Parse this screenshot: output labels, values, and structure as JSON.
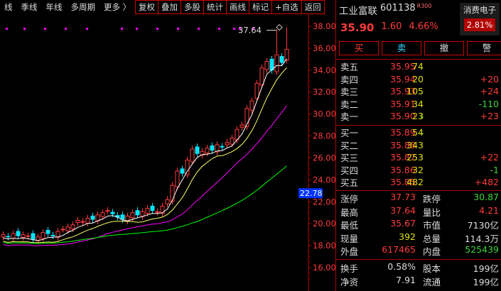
{
  "toolbar": {
    "left_items": [
      "线",
      "季线",
      "年线",
      "多周期",
      "更多 〉"
    ],
    "right_buttons": [
      "复权",
      "叠加",
      "多股",
      "统计",
      "画线",
      "标记",
      "+自选",
      "返回"
    ]
  },
  "stock": {
    "name": "工业富联",
    "code": "601138",
    "badge": "R300",
    "price": "35.90",
    "change": "1.60",
    "change_pct": "4.66%",
    "sector_name": "消费电子",
    "sector_pct": "2.81%"
  },
  "trade_buttons": [
    "买",
    "卖",
    "撤",
    "警"
  ],
  "sell_orders": [
    {
      "label": "卖五",
      "price": "35.95",
      "arrow": "",
      "vol": "74",
      "chg": "",
      "chg_color": "#ff3b3b"
    },
    {
      "label": "卖四",
      "price": "35.94",
      "arrow": "",
      "vol": "20",
      "chg": "+20",
      "chg_color": "#ff3b3b"
    },
    {
      "label": "卖三",
      "price": "35.93",
      "arrow": "",
      "vol": "105",
      "chg": "+24",
      "chg_color": "#ff3b3b"
    },
    {
      "label": "卖二",
      "price": "35.91",
      "arrow": "",
      "vol": "34",
      "chg": "-110",
      "chg_color": "#39d639"
    },
    {
      "label": "卖一",
      "price": "35.90",
      "arrow": "↓",
      "vol": "23",
      "chg": "+23",
      "chg_color": "#ff3b3b"
    }
  ],
  "buy_orders": [
    {
      "label": "买一",
      "price": "35.89",
      "arrow": "↓",
      "vol": "54",
      "chg": "",
      "chg_color": "#ff3b3b"
    },
    {
      "label": "买二",
      "price": "35.88",
      "arrow": "",
      "vol": "343",
      "chg": "",
      "chg_color": "#ff3b3b"
    },
    {
      "label": "买三",
      "price": "35.87",
      "arrow": "",
      "vol": "253",
      "chg": "+22",
      "chg_color": "#ff3b3b"
    },
    {
      "label": "买四",
      "price": "35.86",
      "arrow": "",
      "vol": "32",
      "chg": "-1",
      "chg_color": "#39d639"
    },
    {
      "label": "买五",
      "price": "35.85",
      "arrow": "",
      "vol": "482",
      "chg": "+482",
      "chg_color": "#ff3b3b"
    }
  ],
  "stats_a": [
    {
      "l1": "涨停",
      "v1": "37.73",
      "c1": "#ff3b3b",
      "l2": "跌停",
      "v2": "30.87",
      "c2": "#39d639"
    },
    {
      "l1": "最高",
      "v1": "37.64",
      "c1": "#ff3b3b",
      "l2": "量比",
      "v2": "4.21",
      "c2": "#ff3b3b"
    },
    {
      "l1": "最低",
      "v1": "35.67",
      "c1": "#ff3b3b",
      "l2": "市值",
      "v2": "7130亿",
      "c2": "#dddddd"
    },
    {
      "l1": "现量",
      "v1": "392",
      "c1": "#e0e000",
      "l2": "总量",
      "v2": "114.3万",
      "c2": "#dddddd"
    },
    {
      "l1": "外盘",
      "v1": "617465",
      "c1": "#ff3b3b",
      "l2": "内盘",
      "v2": "525439",
      "c2": "#39d639"
    }
  ],
  "stats_b": [
    {
      "l1": "换手",
      "v1": "0.58%",
      "c1": "#dddddd",
      "l2": "股本",
      "v2": "199亿",
      "c2": "#dddddd"
    },
    {
      "l1": "净资",
      "v1": "7.91",
      "c1": "#dddddd",
      "l2": "流通",
      "v2": "199亿",
      "c2": "#dddddd"
    }
  ],
  "chart": {
    "y_ticks": [
      "38.00",
      "36.00",
      "34.00",
      "32.00",
      "30.00",
      "28.00",
      "26.00",
      "24.00",
      "22.00",
      "20.00",
      "18.00",
      "16.00"
    ],
    "high_label": "37.64",
    "low_label": "22.78",
    "up_color": "#ff3b3b",
    "down_color": "#00e5ff",
    "ma_colors": [
      "#ffffff",
      "#ffff66",
      "#ff00ff",
      "#00ff00"
    ]
  }
}
